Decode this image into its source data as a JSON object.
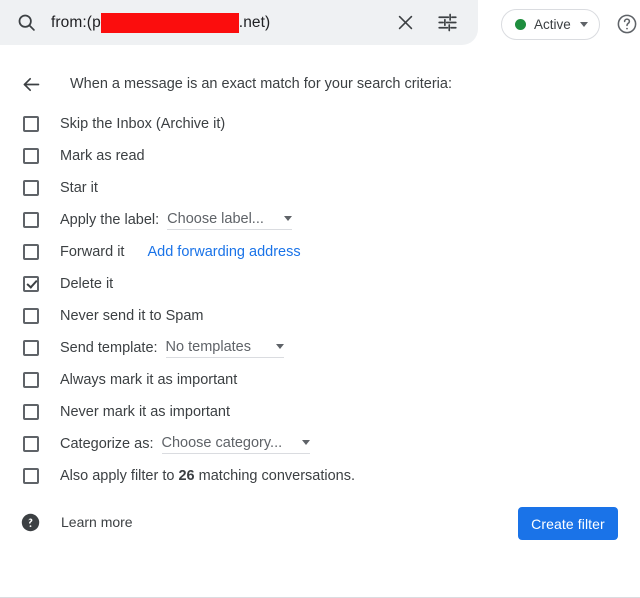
{
  "search": {
    "icon": "search-icon",
    "query_prefix": "from:(p",
    "query_suffix": ".net)",
    "redacted": true,
    "clear_icon": "close-icon",
    "tune_icon": "tune-icon"
  },
  "status": {
    "label": "Active",
    "dot_color": "#1e8e3e",
    "caret_icon": "chevron-down-icon"
  },
  "help_icon": "help-outline-icon",
  "panel": {
    "back_icon": "arrow-back-icon",
    "header": "When a message is an exact match for your search criteria:",
    "options": [
      {
        "id": "skip-inbox",
        "label": "Skip the Inbox (Archive it)",
        "checked": false
      },
      {
        "id": "mark-as-read",
        "label": "Mark as read",
        "checked": false
      },
      {
        "id": "star-it",
        "label": "Star it",
        "checked": false
      },
      {
        "id": "apply-label",
        "label": "Apply the label:",
        "checked": false,
        "dropdown": "Choose label..."
      },
      {
        "id": "forward-it",
        "label": "Forward it",
        "checked": false,
        "link": "Add forwarding address"
      },
      {
        "id": "delete-it",
        "label": "Delete it",
        "checked": true
      },
      {
        "id": "never-spam",
        "label": "Never send it to Spam",
        "checked": false
      },
      {
        "id": "send-template",
        "label": "Send template:",
        "checked": false,
        "dropdown": "No templates"
      },
      {
        "id": "always-important",
        "label": "Always mark it as important",
        "checked": false
      },
      {
        "id": "never-important",
        "label": "Never mark it as important",
        "checked": false
      },
      {
        "id": "categorize-as",
        "label": "Categorize as:",
        "checked": false,
        "dropdown": "Choose category..."
      },
      {
        "id": "apply-to-existing",
        "label_before": "Also apply filter to ",
        "match_count": "26",
        "label_after": " matching conversations.",
        "checked": false
      }
    ]
  },
  "footer": {
    "help_icon": "help-filled-icon",
    "learn_more": "Learn more",
    "create_filter": "Create filter",
    "accent_color": "#1a73e8"
  }
}
